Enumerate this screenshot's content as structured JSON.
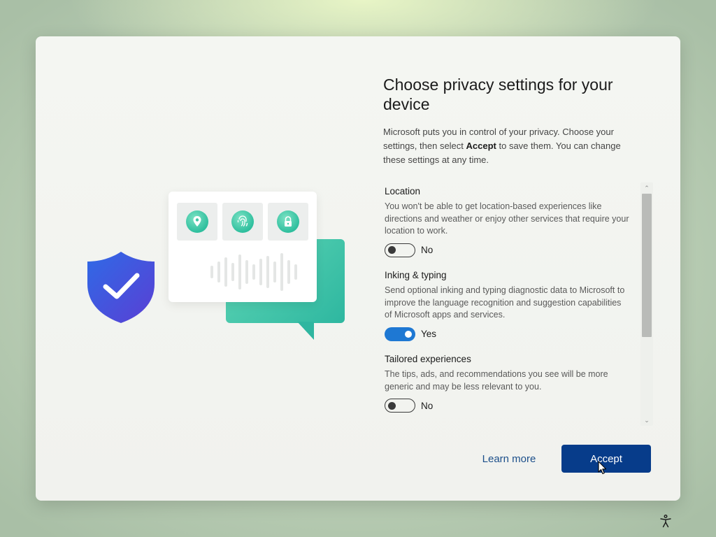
{
  "window": {
    "title": "Choose privacy settings for your device",
    "intro_part1": "Microsoft puts you in control of your privacy. Choose your settings, then select ",
    "intro_bold": "Accept",
    "intro_part2": " to save them. You can change these settings at any time."
  },
  "illustration": {
    "tile_icons": [
      "location-pin-icon",
      "fingerprint-icon",
      "lock-icon"
    ],
    "shield_icon": "shield-check-icon",
    "colors": {
      "teal": "#2fbf9e",
      "shield_blue": "#2f5fe0",
      "shield_purple": "#5b3ed6"
    }
  },
  "settings": [
    {
      "title": "Location",
      "description": "You won't be able to get location-based experiences like directions and weather or enjoy other services that require your location to work.",
      "state": "off",
      "state_label": "No"
    },
    {
      "title": "Inking & typing",
      "description": "Send optional inking and typing diagnostic data to Microsoft to improve the language recognition and suggestion capabilities of Microsoft apps and services.",
      "state": "on",
      "state_label": "Yes"
    },
    {
      "title": "Tailored experiences",
      "description": "The tips, ads, and recommendations you see will be more generic and may be less relevant to you.",
      "state": "off",
      "state_label": "No"
    }
  ],
  "buttons": {
    "learn_more": "Learn more",
    "accept": "Accept"
  },
  "colors": {
    "accent": "#073c8a",
    "toggle_on": "#1e78d3",
    "link": "#1c4f8a"
  },
  "taskbar": {
    "accessibility_icon": "accessibility-icon"
  }
}
